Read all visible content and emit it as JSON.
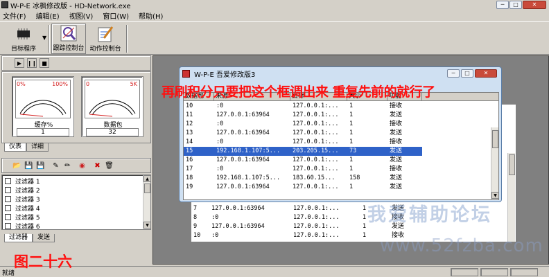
{
  "window": {
    "title": "W-P-E 冰枫修改版 - HD-Network.exe"
  },
  "menu": [
    "文件(F)",
    "编辑(E)",
    "视图(V)",
    "窗口(W)",
    "帮助(H)"
  ],
  "toolbar": {
    "target": "目标程序",
    "trace": "跟踪控制台",
    "action": "动作控制台"
  },
  "gauges": [
    {
      "label": "缓存%",
      "min": "0%",
      "max": "100%",
      "value": "1",
      "level": 0.01
    },
    {
      "label": "数据包",
      "min": "0",
      "max": "5K",
      "value": "32",
      "level": 0.006
    }
  ],
  "gauge_tabs": [
    "仪表",
    "详细"
  ],
  "filters": [
    "过滤器 1",
    "过滤器 2",
    "过滤器 3",
    "过滤器 4",
    "过滤器 5",
    "过滤器 6"
  ],
  "filter_tabs": [
    "过滤器",
    "发送"
  ],
  "status": {
    "text": "就绪"
  },
  "front_window": {
    "title": "W-P-E 吾爱修改版3",
    "columns": [
      "数据包",
      "来源",
      "目标",
      "大小",
      "功能"
    ],
    "rows": [
      [
        "10",
        ":0",
        "127.0.0.1:...",
        "1",
        "接收"
      ],
      [
        "11",
        "127.0.0.1:63964",
        "127.0.0.1:...",
        "1",
        "发送"
      ],
      [
        "12",
        ":0",
        "127.0.0.1:...",
        "1",
        "接收"
      ],
      [
        "13",
        "127.0.0.1:63964",
        "127.0.0.1:...",
        "1",
        "发送"
      ],
      [
        "14",
        ":0",
        "127.0.0.1:...",
        "1",
        "接收"
      ],
      [
        "15",
        "192.168.1.107:5...",
        "203.205.15...",
        "73",
        "发送"
      ],
      [
        "16",
        "127.0.0.1:63964",
        "127.0.0.1:...",
        "1",
        "发送"
      ],
      [
        "17",
        ":0",
        "127.0.0.1:...",
        "1",
        "接收"
      ],
      [
        "18",
        "192.168.1.107:5...",
        "183.60.15...",
        "158",
        "发送"
      ],
      [
        "19",
        "127.0.0.1:63964",
        "127.0.0.1:...",
        "1",
        "发送"
      ]
    ],
    "selected_row": 5
  },
  "back_window": {
    "rows": [
      [
        "7",
        "127.0.0.1:63964",
        "127.0.0.1:...",
        "1",
        "发送"
      ],
      [
        "8",
        ":0",
        "127.0.0.1:...",
        "1",
        "接收"
      ],
      [
        "9",
        "127.0.0.1:63964",
        "127.0.0.1:...",
        "1",
        "发送"
      ],
      [
        "10",
        ":0",
        "127.0.0.1:...",
        "1",
        "接收"
      ]
    ]
  },
  "annotation": "再刷积分只要把这个框调出来 重复先前的就行了",
  "figure_label": "图二十六",
  "watermark": {
    "line1": "我爱辅助论坛",
    "line2": "www.52fzba.com"
  },
  "colors": {
    "selection": "#2f62c8",
    "annotation": "#ff1010",
    "face": "#d4d0c8"
  }
}
